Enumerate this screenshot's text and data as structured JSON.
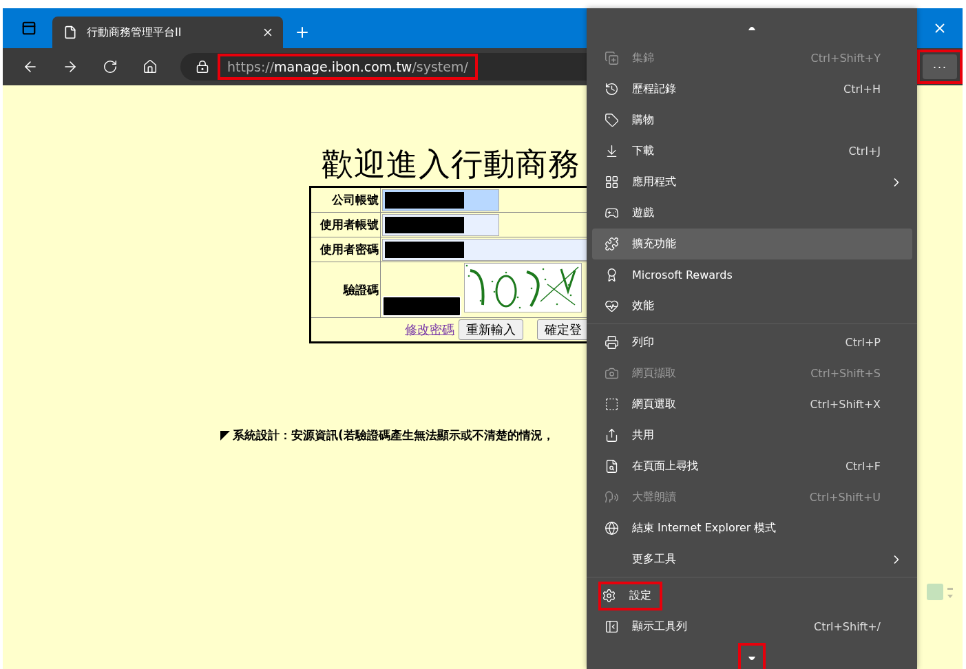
{
  "browser": {
    "tab": {
      "title": "行動商務管理平台II",
      "selected": true
    },
    "address": {
      "scheme": "https://",
      "host": "manage.ibon.com.tw",
      "path": "/system/",
      "highlighted": true
    },
    "more_button": {
      "label": "···",
      "highlighted": true
    }
  },
  "page": {
    "title": "歡迎進入行動商務",
    "fields": [
      {
        "label": "公司帳號",
        "redacted": true,
        "focused": true,
        "wide": false
      },
      {
        "label": "使用者帳號",
        "redacted": true,
        "focused": false,
        "wide": false
      },
      {
        "label": "使用者密碼",
        "redacted": true,
        "focused": false,
        "wide": true
      }
    ],
    "captcha": {
      "label": "驗證碼",
      "redacted": true
    },
    "change_password_link": "修改密碼",
    "buttons": [
      "重新輸入",
      "確定登"
    ],
    "footer": "系統設計：安源資訊(若驗證碼產生無法顯示或不清楚的情況，"
  },
  "menu": {
    "scroll_up": {
      "highlighted": false
    },
    "sections": [
      [
        {
          "label": "集錦",
          "shortcut": "Ctrl+Shift+Y",
          "disabled": true,
          "hovered": false,
          "submenu": false,
          "highlighted": false
        },
        {
          "label": "歷程記錄",
          "shortcut": "Ctrl+H",
          "disabled": false,
          "hovered": false,
          "submenu": false,
          "highlighted": false
        },
        {
          "label": "購物",
          "disabled": false,
          "hovered": false,
          "submenu": false,
          "highlighted": false
        },
        {
          "label": "下載",
          "shortcut": "Ctrl+J",
          "disabled": false,
          "hovered": false,
          "submenu": false,
          "highlighted": false
        },
        {
          "label": "應用程式",
          "disabled": false,
          "hovered": false,
          "submenu": true,
          "highlighted": false
        },
        {
          "label": "遊戲",
          "disabled": false,
          "hovered": false,
          "submenu": false,
          "highlighted": false
        },
        {
          "label": "擴充功能",
          "disabled": false,
          "hovered": true,
          "submenu": false,
          "highlighted": false
        },
        {
          "label": "Microsoft Rewards",
          "disabled": false,
          "hovered": false,
          "submenu": false,
          "highlighted": false
        },
        {
          "label": "效能",
          "disabled": false,
          "hovered": false,
          "submenu": false,
          "highlighted": false
        }
      ],
      [
        {
          "label": "列印",
          "shortcut": "Ctrl+P",
          "disabled": false,
          "hovered": false,
          "submenu": false,
          "highlighted": false
        },
        {
          "label": "網頁擷取",
          "shortcut": "Ctrl+Shift+S",
          "disabled": true,
          "hovered": false,
          "submenu": false,
          "highlighted": false
        },
        {
          "label": "網頁選取",
          "shortcut": "Ctrl+Shift+X",
          "disabled": false,
          "hovered": false,
          "submenu": false,
          "highlighted": false
        },
        {
          "label": "共用",
          "disabled": false,
          "hovered": false,
          "submenu": false,
          "highlighted": false
        },
        {
          "label": "在頁面上尋找",
          "shortcut": "Ctrl+F",
          "disabled": false,
          "hovered": false,
          "submenu": false,
          "highlighted": false
        },
        {
          "label": "大聲朗讀",
          "shortcut": "Ctrl+Shift+U",
          "disabled": true,
          "hovered": false,
          "submenu": false,
          "highlighted": false
        },
        {
          "label": "結束 Internet Explorer 模式",
          "disabled": false,
          "hovered": false,
          "submenu": false,
          "highlighted": false
        },
        {
          "label": "更多工具",
          "disabled": false,
          "hovered": false,
          "submenu": true,
          "highlighted": false
        }
      ],
      [
        {
          "label": "設定",
          "disabled": false,
          "hovered": false,
          "submenu": false,
          "highlighted": true
        },
        {
          "label": "顯示工具列",
          "shortcut": "Ctrl+Shift+/",
          "disabled": false,
          "hovered": false,
          "submenu": false,
          "highlighted": false
        }
      ]
    ],
    "scroll_down": {
      "highlighted": true
    }
  }
}
